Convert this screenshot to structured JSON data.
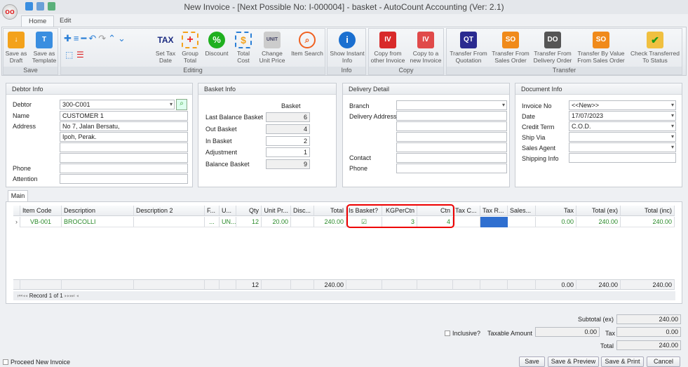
{
  "window": {
    "title": "New Invoice - [Next Possible No: I-000004] - basket - AutoCount Accounting (Ver: 2.1)",
    "logo_text": "oo"
  },
  "ribbon_tabs": [
    {
      "label": "Home"
    },
    {
      "label": "Edit"
    }
  ],
  "ribbon": {
    "save": {
      "label": "Save",
      "buttons": [
        "Save as\nDraft",
        "Save as\nTemplate"
      ]
    },
    "editing": {
      "label": "Editing",
      "buttons": [
        "Set Tax\nDate",
        "Group\nTotal",
        "Discount",
        "Total\nCost",
        "Change\nUnit Price",
        "Item Search"
      ]
    },
    "info": {
      "label": "Info",
      "buttons": [
        "Show Instant\nInfo"
      ]
    },
    "copy": {
      "label": "Copy",
      "buttons": [
        "Copy from\nother Invoice",
        "Copy to a\nnew Invoice"
      ]
    },
    "transfer": {
      "label": "Transfer",
      "buttons": [
        "Transfer From\nQuotation",
        "Transfer From\nSales Order",
        "Transfer From\nDelivery Order",
        "Transfer By Value\nFrom Sales Order",
        "Check Transferred\nTo Status"
      ]
    },
    "icon_text": {
      "tax": "TAX",
      "unit": "UNIT",
      "iv": "IV",
      "qt": "QT",
      "so": "SO",
      "do": "DO",
      "pct": "%",
      "dollar": "$"
    }
  },
  "debtor": {
    "title": "Debtor Info",
    "debtor_label": "Debtor",
    "debtor": "300-C001",
    "name_label": "Name",
    "name": "CUSTOMER 1",
    "address_label": "Address",
    "address": [
      "No 7, Jalan Bersatu,",
      "Ipoh, Perak.",
      "",
      ""
    ],
    "phone_label": "Phone",
    "phone": "",
    "attention_label": "Attention",
    "attention": ""
  },
  "basket": {
    "title": "Basket Info",
    "col": "Basket",
    "rows": [
      {
        "label": "Last Balance Basket",
        "value": "6"
      },
      {
        "label": "Out Basket",
        "value": "4"
      },
      {
        "label": "In Basket",
        "value": "2"
      },
      {
        "label": "Adjustment",
        "value": "1"
      },
      {
        "label": "Balance Basket",
        "value": "9"
      }
    ]
  },
  "delivery": {
    "title": "Delivery Detail",
    "branch_label": "Branch",
    "address_label": "Delivery Address",
    "contact_label": "Contact",
    "phone_label": "Phone"
  },
  "document": {
    "title": "Document Info",
    "rows": [
      {
        "label": "Invoice No",
        "value": "<<New>>"
      },
      {
        "label": "Date",
        "value": "17/07/2023"
      },
      {
        "label": "Credit Term",
        "value": "C.O.D."
      },
      {
        "label": "Ship Via",
        "value": ""
      },
      {
        "label": "Sales Agent",
        "value": ""
      },
      {
        "label": "Shipping Info",
        "value": ""
      }
    ]
  },
  "main_tab": "Main",
  "grid": {
    "columns": [
      "Item Code",
      "Description",
      "Description 2",
      "F...",
      "U...",
      "Qty",
      "Unit Pr...",
      "Disc...",
      "Total",
      "Is Basket?",
      "KGPerCtn",
      "Ctn",
      "Tax C...",
      "Tax R...",
      "Sales...",
      "Tax",
      "Total (ex)",
      "Total (inc)"
    ],
    "rows": [
      [
        "VB-001",
        "BROCOLLI",
        "",
        "...",
        "UN...",
        "12",
        "20.00",
        "",
        "240.00",
        "☑",
        "3",
        "4",
        "",
        "",
        "",
        "0.00",
        "240.00",
        "240.00"
      ]
    ],
    "footer": [
      "",
      "",
      "",
      "",
      "",
      "12",
      "",
      "",
      "240.00",
      "",
      "",
      "",
      "",
      "",
      "",
      "0.00",
      "240.00",
      "240.00"
    ],
    "navigator": "Record 1 of 1",
    "row_indicator": "›"
  },
  "totals": {
    "subtotal_label": "Subtotal (ex)",
    "subtotal": "240.00",
    "inclusive_label": "Inclusive?",
    "taxable_label": "Taxable Amount",
    "taxable": "0.00",
    "tax_label": "Tax",
    "tax": "0.00",
    "total_label": "Total",
    "total": "240.00"
  },
  "footer": {
    "proceed_label": "Proceed New Invoice",
    "save": "Save",
    "save_preview": "Save & Preview",
    "save_print": "Save & Print",
    "cancel": "Cancel"
  },
  "colors": {
    "highlight": "#e00000",
    "row_text": "#2a8a2a",
    "selected_cell": "#2f6fd0"
  }
}
